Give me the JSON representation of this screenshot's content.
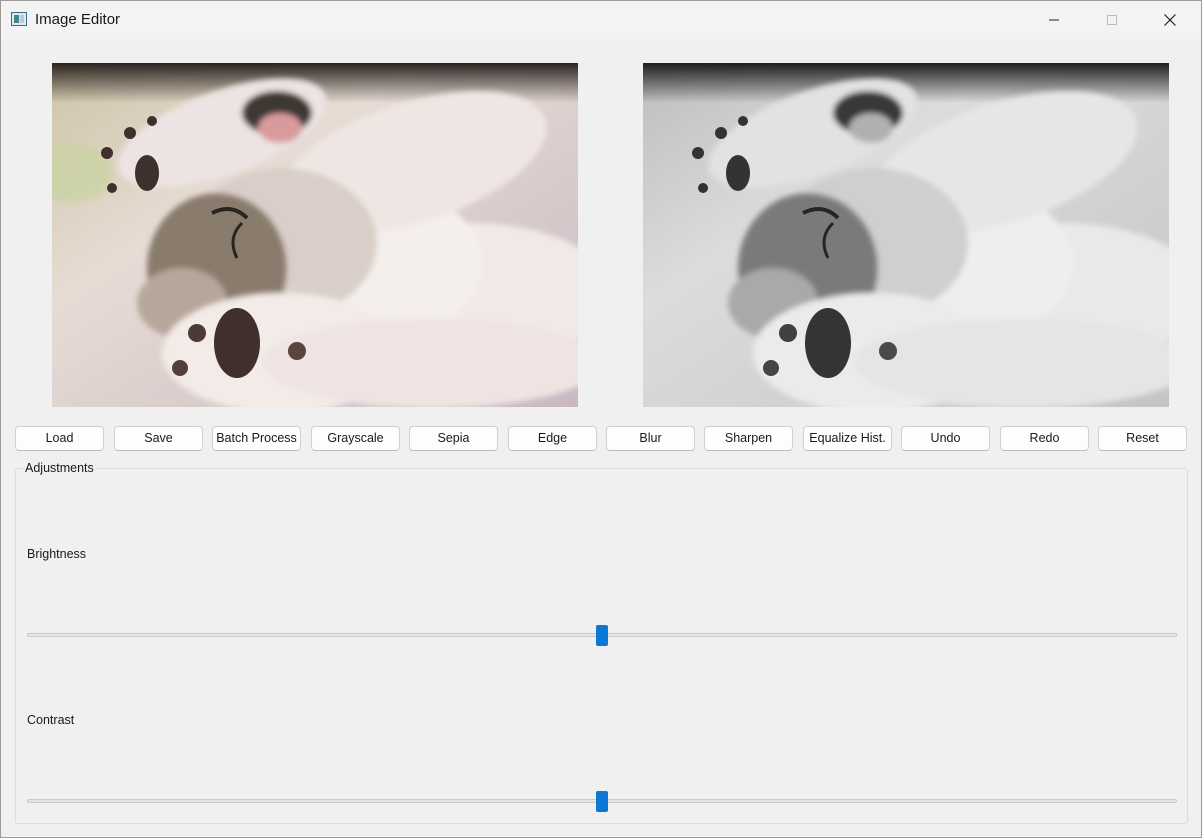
{
  "window": {
    "title": "Image Editor",
    "icons": {
      "app": "app-window-icon",
      "minimize": "minimize-icon",
      "maximize": "maximize-icon",
      "close": "close-icon"
    }
  },
  "images": {
    "original": "kitten-photo-color",
    "processed": "kitten-photo-grayscale"
  },
  "toolbar": {
    "buttons": [
      {
        "label": "Load"
      },
      {
        "label": "Save"
      },
      {
        "label": "Batch Process"
      },
      {
        "label": "Grayscale"
      },
      {
        "label": "Sepia"
      },
      {
        "label": "Edge"
      },
      {
        "label": "Blur"
      },
      {
        "label": "Sharpen"
      },
      {
        "label": "Equalize Hist."
      },
      {
        "label": "Undo"
      },
      {
        "label": "Redo"
      },
      {
        "label": "Reset"
      }
    ]
  },
  "adjustments": {
    "title": "Adjustments",
    "sliders": [
      {
        "label": "Brightness",
        "value_fraction": 0.5
      },
      {
        "label": "Contrast",
        "value_fraction": 0.5
      }
    ]
  },
  "colors": {
    "accent": "#0a78d4",
    "window_bg": "#f0f0f0"
  }
}
